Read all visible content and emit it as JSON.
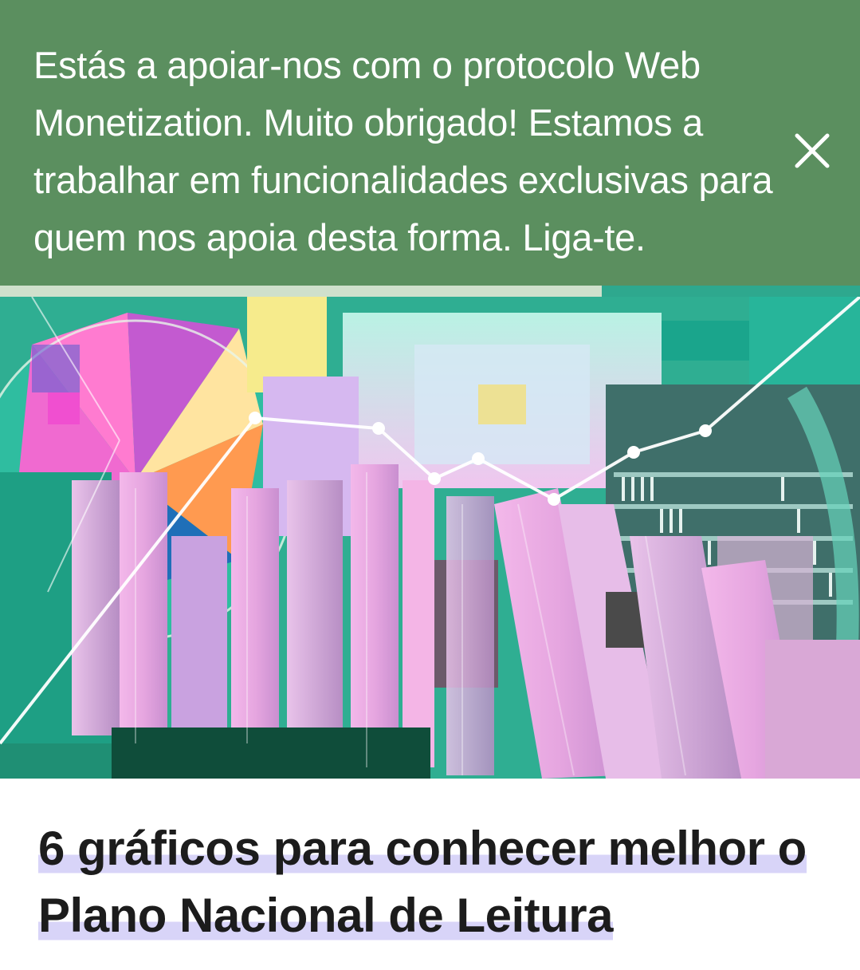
{
  "banner": {
    "message": "Estás a apoiar-nos com o protocolo Web Monetization. Muito obrigado! Estamos a trabalhar em funcionalidades exclusivas para quem nos apoia desta forma. Liga-te.",
    "close_icon": "close-icon",
    "background_color": "#5b8f5f"
  },
  "reading_progress": {
    "fraction": 0.7
  },
  "hero_image": {
    "description_icon": "collage-image"
  },
  "article": {
    "title_line1": "6 gráficos para conhecer melhor o",
    "title_line2": "Plano Nacional de Leitura",
    "highlight_color": "#d8d4f8"
  }
}
